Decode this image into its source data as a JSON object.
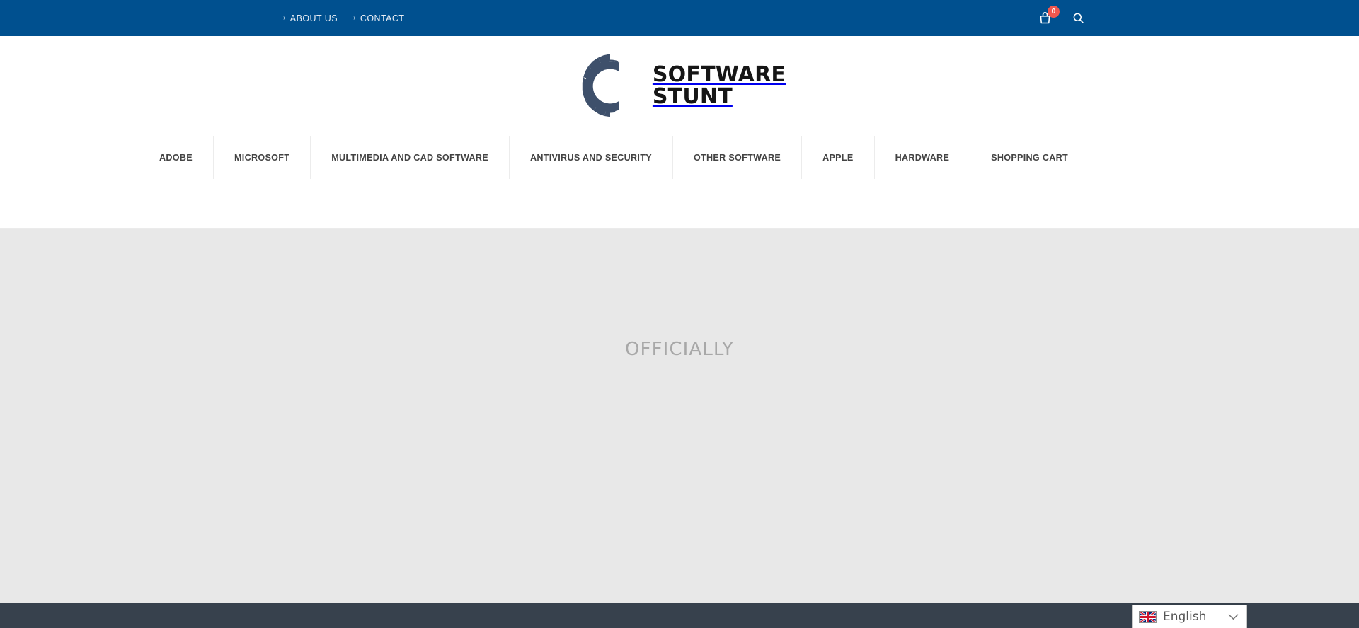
{
  "topbar": {
    "background": "#00508f",
    "links": [
      {
        "label": "ABOUT US",
        "marker": "chevron-right-icon"
      },
      {
        "label": "CONTACT",
        "marker": "chevron-right-icon"
      }
    ],
    "cart": {
      "icon": "shopping-bag-icon",
      "count": "0",
      "badge_color": "#f0574f"
    },
    "search": {
      "icon": "search-icon"
    }
  },
  "logo": {
    "icon": "gear-icon",
    "icon_color": "#3e506b",
    "line1": "SOFTWARE",
    "line2": "STUNT",
    "text_color": "#161616"
  },
  "nav": {
    "items": [
      {
        "label": "ADOBE"
      },
      {
        "label": "MICROSOFT"
      },
      {
        "label": "MULTIMEDIA AND CAD SOFTWARE"
      },
      {
        "label": "ANTIVIRUS AND SECURITY"
      },
      {
        "label": "OTHER SOFTWARE"
      },
      {
        "label": "APPLE"
      },
      {
        "label": "HARDWARE"
      },
      {
        "label": "SHOPPING CART"
      }
    ]
  },
  "hero": {
    "caption": "OFFICIALLY",
    "background": "#e8e8e8",
    "caption_color": "#a8a8a8"
  },
  "footer": {
    "background": "#37414d"
  },
  "language_selector": {
    "flag": "uk-flag-icon",
    "label": "English",
    "chevron": "chevron-down-icon"
  }
}
